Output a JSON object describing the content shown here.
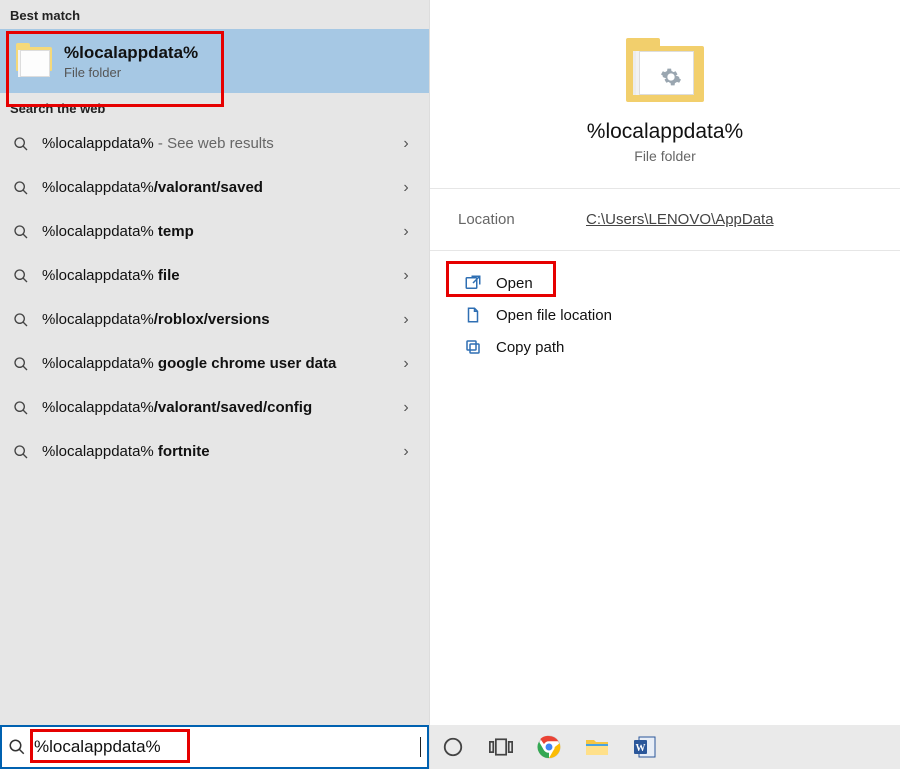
{
  "left": {
    "best_match_header": "Best match",
    "best_match": {
      "title": "%localappdata%",
      "subtitle": "File folder"
    },
    "web_header": "Search the web",
    "items": [
      {
        "prefix": "%localappdata%",
        "suffix": "",
        "note": " - See web results"
      },
      {
        "prefix": "%localappdata%",
        "suffix": "/valorant/saved",
        "note": ""
      },
      {
        "prefix": "%localappdata%",
        "suffix": " temp",
        "note": ""
      },
      {
        "prefix": "%localappdata%",
        "suffix": " file",
        "note": ""
      },
      {
        "prefix": "%localappdata%",
        "suffix": "/roblox/versions",
        "note": ""
      },
      {
        "prefix": "%localappdata%",
        "suffix": " google chrome user data",
        "note": ""
      },
      {
        "prefix": "%localappdata%",
        "suffix": "/valorant/saved/config",
        "note": ""
      },
      {
        "prefix": "%localappdata%",
        "suffix": " fortnite",
        "note": ""
      }
    ],
    "search_value": "%localappdata%"
  },
  "right": {
    "title": "%localappdata%",
    "subtitle": "File folder",
    "meta_key": "Location",
    "meta_val": "C:\\Users\\LENOVO\\AppData",
    "actions": {
      "open": "Open",
      "open_location": "Open file location",
      "copy_path": "Copy path"
    }
  }
}
